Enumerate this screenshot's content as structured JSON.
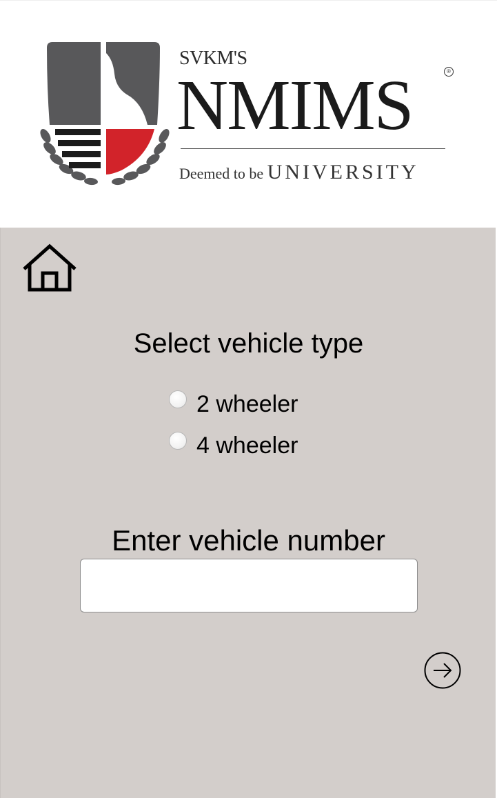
{
  "logo": {
    "prefix": "SVKM'S",
    "name": "NMIMS",
    "registered_mark": "®",
    "tagline_small": "Deemed to be ",
    "tagline_large": "UNIVERSITY",
    "colors": {
      "grey": "#58585a",
      "red": "#d2232a",
      "black": "#1b1b1b"
    }
  },
  "nav": {
    "home_icon": "home-icon"
  },
  "form": {
    "title": "Select vehicle type",
    "options": [
      {
        "label": "2 wheeler",
        "selected": false
      },
      {
        "label": "4 wheeler",
        "selected": false
      }
    ],
    "vehicle_number_label": "Enter vehicle number",
    "vehicle_number_value": "",
    "vehicle_number_placeholder": "",
    "submit_icon": "arrow-right-circle-icon"
  },
  "colors": {
    "panel_background": "#d3cecb",
    "header_background": "#ffffff"
  }
}
